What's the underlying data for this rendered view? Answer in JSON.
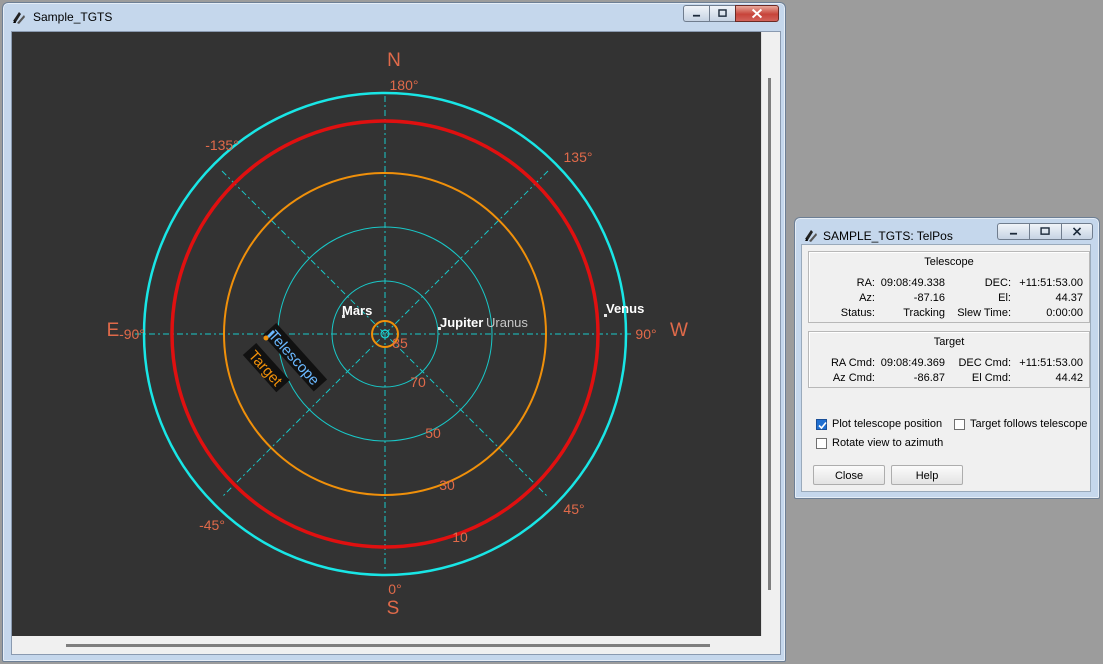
{
  "main_window": {
    "title": "Sample_TGTS"
  },
  "sky_plot": {
    "compass": {
      "north": "N",
      "south": "S",
      "east": "E",
      "west": "W"
    },
    "azimuth_labels": [
      "180°",
      "135°",
      "90°",
      "45°",
      "0°",
      "-45°",
      "-90°",
      "-135°"
    ],
    "elevation_labels": [
      "85",
      "70",
      "50",
      "30",
      "10"
    ],
    "objects": [
      {
        "name": "Mars"
      },
      {
        "name": "Jupiter"
      },
      {
        "name": "Uranus"
      },
      {
        "name": "Venus"
      }
    ],
    "telescope_label": "Telescope",
    "target_label": "Target",
    "colors": {
      "background": "#333333",
      "horizon_ring": "#19e6e6",
      "limit_ring_red": "#e01010",
      "limit_ring_orange": "#f0900a",
      "grid": "#19c8c8",
      "labels": "#e06a4a",
      "telescope": "#6ab8ff",
      "target": "#f0900a"
    }
  },
  "telpos_window": {
    "title": "SAMPLE_TGTS: TelPos",
    "telescope_group": {
      "title": "Telescope",
      "ra_label": "RA:",
      "ra": "09:08:49.338",
      "dec_label": "DEC:",
      "dec": "+11:51:53.00",
      "az_label": "Az:",
      "az": "-87.16",
      "el_label": "El:",
      "el": "44.37",
      "status_label": "Status:",
      "status": "Tracking",
      "slew_label": "Slew Time:",
      "slew": "0:00:00"
    },
    "target_group": {
      "title": "Target",
      "ra_cmd_label": "RA Cmd:",
      "ra_cmd": "09:08:49.369",
      "dec_cmd_label": "DEC Cmd:",
      "dec_cmd": "+11:51:53.00",
      "az_cmd_label": "Az Cmd:",
      "az_cmd": "-86.87",
      "el_cmd_label": "El Cmd:",
      "el_cmd": "44.42"
    },
    "options": {
      "plot_telescope": {
        "label": "Plot telescope position",
        "checked": true
      },
      "target_follows": {
        "label": "Target follows telescope",
        "checked": false
      },
      "rotate_view": {
        "label": "Rotate view to azimuth",
        "checked": false
      }
    },
    "buttons": {
      "close": "Close",
      "help": "Help"
    }
  }
}
